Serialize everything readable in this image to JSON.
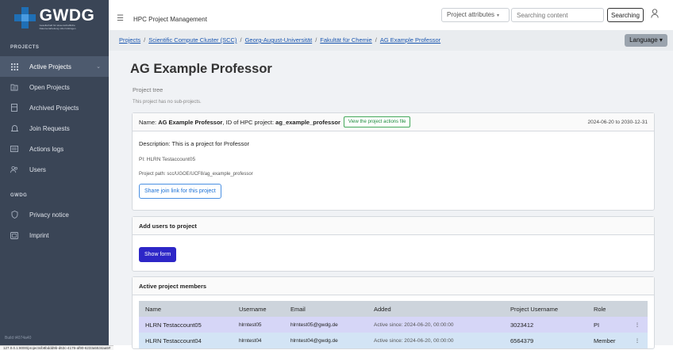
{
  "logo": {
    "word": "GWDG",
    "sub": "Gesellschaft für wissenschaftliche Datenverarbeitung mbH Göttingen"
  },
  "sidebar": {
    "section_projects": "PROJECTS",
    "section_gwdg": "GWDG",
    "items": [
      {
        "label": "Active Projects",
        "icon": "grid-icon"
      },
      {
        "label": "Open Projects",
        "icon": "folder-open-icon"
      },
      {
        "label": "Archived Projects",
        "icon": "archive-icon"
      },
      {
        "label": "Join Requests",
        "icon": "bell-icon"
      },
      {
        "label": "Actions logs",
        "icon": "list-icon"
      },
      {
        "label": "Users",
        "icon": "users-icon"
      }
    ],
    "gwdg_items": [
      {
        "label": "Privacy notice",
        "icon": "shield-icon"
      },
      {
        "label": "Imprint",
        "icon": "document-icon"
      }
    ],
    "build": "Build t4074a40"
  },
  "statusbar": {
    "url": "127.0.0.1:8000/projects/b8bddd9b-d63c-4176-af90-6233a5534aa5#"
  },
  "topbar": {
    "title": "HPC Project Management",
    "attr_select": "Project attributes",
    "search_placeholder": "Searching content",
    "search_button": "Searching"
  },
  "breadcrumb": {
    "items": [
      "Projects",
      "Scientific Compute Cluster (SCC)",
      "Georg-August-Universität",
      "Fakultät für Chemie",
      "AG Example Professor"
    ],
    "separator": "/"
  },
  "language_button": "Language",
  "page": {
    "title": "AG Example Professor",
    "tree_heading": "Project tree",
    "tree_note": "This project has no sub-projects."
  },
  "project_card": {
    "name_prefix": "Name: ",
    "name": "AG Example Professor",
    "id_prefix": ", ID of HPC project: ",
    "id": "ag_example_professor",
    "actions_button": "View the project actions file",
    "dates": "2024-06-20 to 2030-12-31",
    "description": "Description: This is a project for Professor",
    "pi": "PI: HLRN Testaccount05",
    "path": "Project path: scc/UGOE/UCF8/ag_example_professor",
    "share_button": "Share join link for this project"
  },
  "add_users_card": {
    "header": "Add users to project",
    "button": "Show form"
  },
  "members_card": {
    "header": "Active project members",
    "columns": [
      "Name",
      "Username",
      "Email",
      "Added",
      "Project Username",
      "Role"
    ],
    "rows": [
      {
        "name": "HLRN Testaccount05",
        "username": "hlrntest05",
        "email": "hlrntest05@gwdg.de",
        "added": "Active since: 2024-06-20, 00:00:00",
        "project_username": "3023412",
        "role": "PI"
      },
      {
        "name": "HLRN Testaccount04",
        "username": "hlrntest04",
        "email": "hlrntest04@gwdg.de",
        "added": "Active since: 2024-06-20, 00:00:00",
        "project_username": "6564379",
        "role": "Member"
      }
    ]
  },
  "colors": {
    "sidebar_bg": "#3a4556",
    "accent_blue": "#1f6fb5",
    "show_form_button": "#2d26c7",
    "row_pi": "#d6d6f7",
    "row_member": "#d3e4f5"
  }
}
